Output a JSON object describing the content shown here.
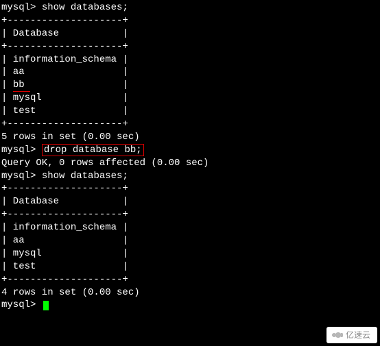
{
  "prompt": "mysql>",
  "commands": {
    "show_dbs": "show databases;",
    "drop_bb": "drop database bb;"
  },
  "table": {
    "border": "+--------------------+",
    "header": "| Database           |",
    "rows1": [
      "| information_schema |",
      "| aa                 |",
      "| bb                 |",
      "| mysql              |",
      "| test               |"
    ],
    "rows2": [
      "| information_schema |",
      "| aa                 |",
      "| mysql              |",
      "| test               |"
    ],
    "highlighted_db": "bb"
  },
  "msgs": {
    "rows5": "5 rows in set (0.00 sec)",
    "rows4": "4 rows in set (0.00 sec)",
    "query_ok": "Query OK, 0 rows affected (0.00 sec)"
  },
  "watermark": "亿速云"
}
